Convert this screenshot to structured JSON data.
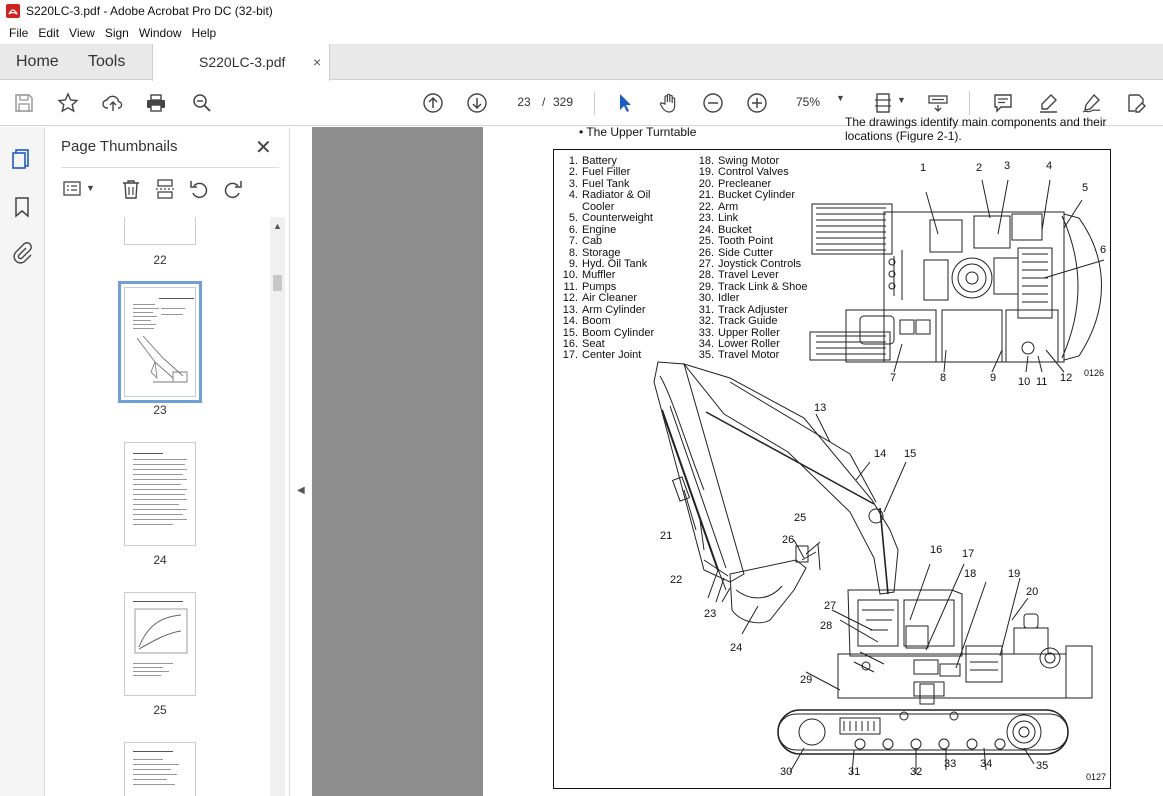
{
  "window": {
    "title": "S220LC-3.pdf - Adobe Acrobat Pro DC (32-bit)"
  },
  "menu": [
    "File",
    "Edit",
    "View",
    "Sign",
    "Window",
    "Help"
  ],
  "tabs": {
    "home": "Home",
    "tools": "Tools",
    "document": "S220LC-3.pdf",
    "close": "×"
  },
  "toolbar": {
    "page_current": "23",
    "page_sep": "/",
    "page_total": "329",
    "zoom": "75%"
  },
  "panel": {
    "title": "Page Thumbnails",
    "close": "✕",
    "thumbnails": [
      {
        "label": "22"
      },
      {
        "label": "23",
        "selected": true
      },
      {
        "label": "24"
      },
      {
        "label": "25"
      }
    ]
  },
  "document": {
    "bullet_text": "• The Upper Turntable",
    "right_text_line1": "The drawings identify main components and their",
    "right_text_line2": "locations (Figure 2-1).",
    "legend_left": [
      [
        "1.",
        "Battery"
      ],
      [
        "2.",
        "Fuel Filler"
      ],
      [
        "3.",
        "Fuel Tank"
      ],
      [
        "4.",
        "Radiator & Oil"
      ],
      [
        "",
        "Cooler"
      ],
      [
        "5.",
        "Counterweight"
      ],
      [
        "6.",
        "Engine"
      ],
      [
        "7.",
        "Cab"
      ],
      [
        "8.",
        "Storage"
      ],
      [
        "9.",
        "Hyd. Oil Tank"
      ],
      [
        "10.",
        "Muffler"
      ],
      [
        "11.",
        "Pumps"
      ],
      [
        "12.",
        "Air Cleaner"
      ],
      [
        "13.",
        "Arm Cylinder"
      ],
      [
        "14.",
        "Boom"
      ],
      [
        "15.",
        "Boom Cylinder"
      ],
      [
        "16.",
        "Seat"
      ],
      [
        "17.",
        "Center Joint"
      ]
    ],
    "legend_right": [
      [
        "18.",
        "Swing Motor"
      ],
      [
        "19.",
        "Control Valves"
      ],
      [
        "20.",
        "Precleaner"
      ],
      [
        "21.",
        "Bucket Cylinder"
      ],
      [
        "22.",
        "Arm"
      ],
      [
        "23.",
        "Link"
      ],
      [
        "24.",
        "Bucket"
      ],
      [
        "25.",
        "Tooth Point"
      ],
      [
        "26.",
        "Side Cutter"
      ],
      [
        "27.",
        "Joystick Controls"
      ],
      [
        "28.",
        "Travel Lever"
      ],
      [
        "29.",
        "Track Link & Shoe"
      ],
      [
        "30.",
        "Idler"
      ],
      [
        "31.",
        "Track Adjuster"
      ],
      [
        "32.",
        "Track Guide"
      ],
      [
        "33.",
        "Upper Roller"
      ],
      [
        "34.",
        "Lower Roller"
      ],
      [
        "35.",
        "Travel Motor"
      ]
    ],
    "callouts_top": [
      "1",
      "2",
      "3",
      "4",
      "5",
      "6",
      "7",
      "8",
      "9",
      "10",
      "11",
      "12"
    ],
    "code_top": "0126",
    "callouts_side": [
      "13",
      "14",
      "15",
      "25",
      "16",
      "17",
      "26",
      "18",
      "19",
      "21",
      "22",
      "20",
      "27",
      "28",
      "23",
      "24",
      "29",
      "30",
      "31",
      "32",
      "33",
      "34",
      "35"
    ],
    "code_bottom": "0127"
  }
}
